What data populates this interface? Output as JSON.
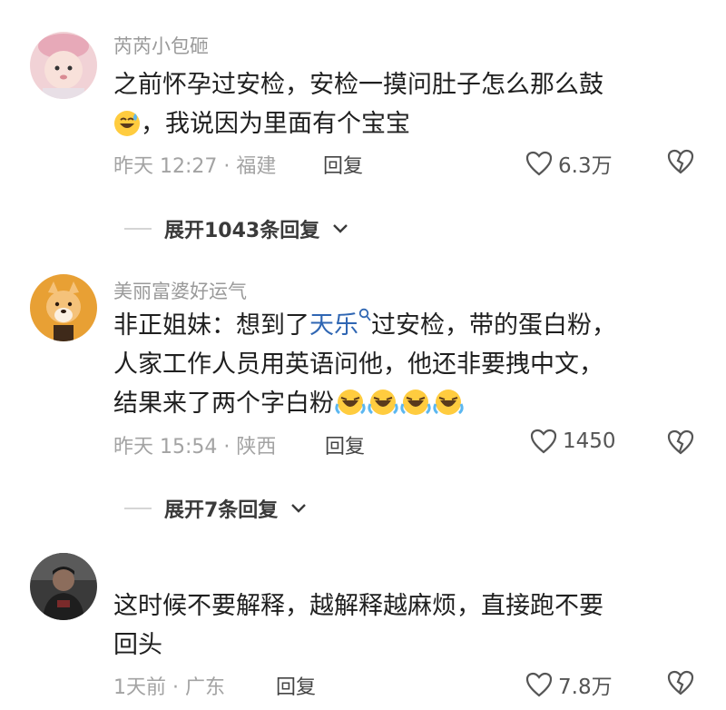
{
  "comments": [
    {
      "username": "芮芮小包砸",
      "text_line1": "之前怀孕过安检，安检一摸问肚子怎么那么鼓",
      "text_line2": "，我说因为里面有个宝宝",
      "time_location": "昨天 12:27 · 福建",
      "reply_label": "回复",
      "likes": "6.3万",
      "expand_label": "展开1043条回复",
      "avatar_icon": "baby-avatar",
      "emoji": "grinning-sweat-emoji"
    },
    {
      "username": "美丽富婆好运气",
      "text_line1_prefix": "非正姐妹：想到了",
      "text_link": "天乐",
      "text_line1_suffix": "过安检，带的蛋白粉，",
      "text_line2": "人家工作人员用英语问他，他还非要拽中文，",
      "text_line3": "结果来了两个字白粉",
      "time_location": "昨天 15:54 · 陕西",
      "reply_label": "回复",
      "likes": "1450",
      "expand_label": "展开7条回复",
      "avatar_icon": "dog-avatar",
      "emoji": "rolling-laughing-emoji"
    },
    {
      "username": "",
      "text_line1": "这时候不要解释，越解释越麻烦，直接跑不要",
      "text_line2": "回头",
      "time_location": "1天前 · 广东",
      "reply_label": "回复",
      "likes": "7.8万",
      "avatar_icon": "man-avatar"
    }
  ],
  "colors": {
    "link": "#2f66b3",
    "meta": "#a3a3a3",
    "username": "#9a9a9a"
  }
}
